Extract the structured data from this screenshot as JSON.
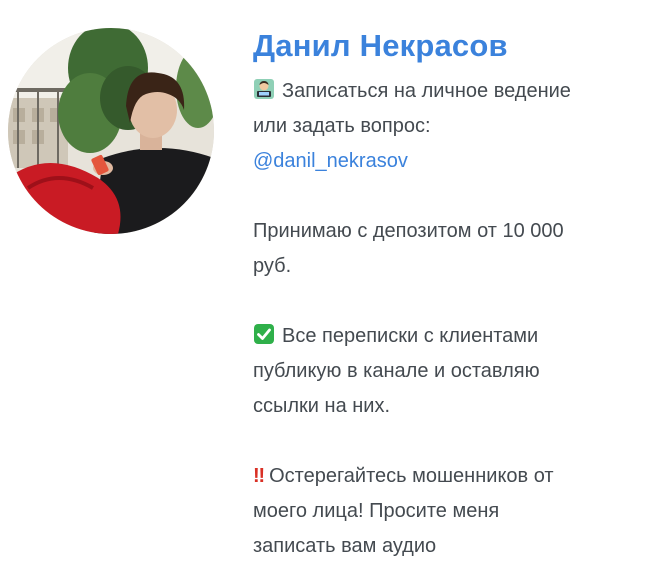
{
  "profile": {
    "name": "Данил Некрасов",
    "avatar_icon": "user-photo-avatar"
  },
  "bio": {
    "line1_emoji": "technologist-emoji",
    "line1_text": "Записаться на личное ведение",
    "line2_text": "или задать вопрос:",
    "mention": "@danil_nekrasov",
    "deposit_line1": "Принимаю с депозитом от 10 000",
    "deposit_line2": "руб.",
    "check_emoji": "check-mark-button-emoji",
    "check_line1": "Все переписки с клиентами",
    "check_line2": "публикую в канале и оставляю",
    "check_line3": "ссылки на них.",
    "warning_mark": "‼",
    "warning_line1": "Остерегайтесь мошенников от",
    "warning_line2": "моего лица! Просите меня",
    "warning_line3": "записать вам аудио"
  },
  "colors": {
    "accent": "#3b82dc",
    "text": "#444a50",
    "check_green": "#2fb04a",
    "warning_red": "#d93025"
  }
}
